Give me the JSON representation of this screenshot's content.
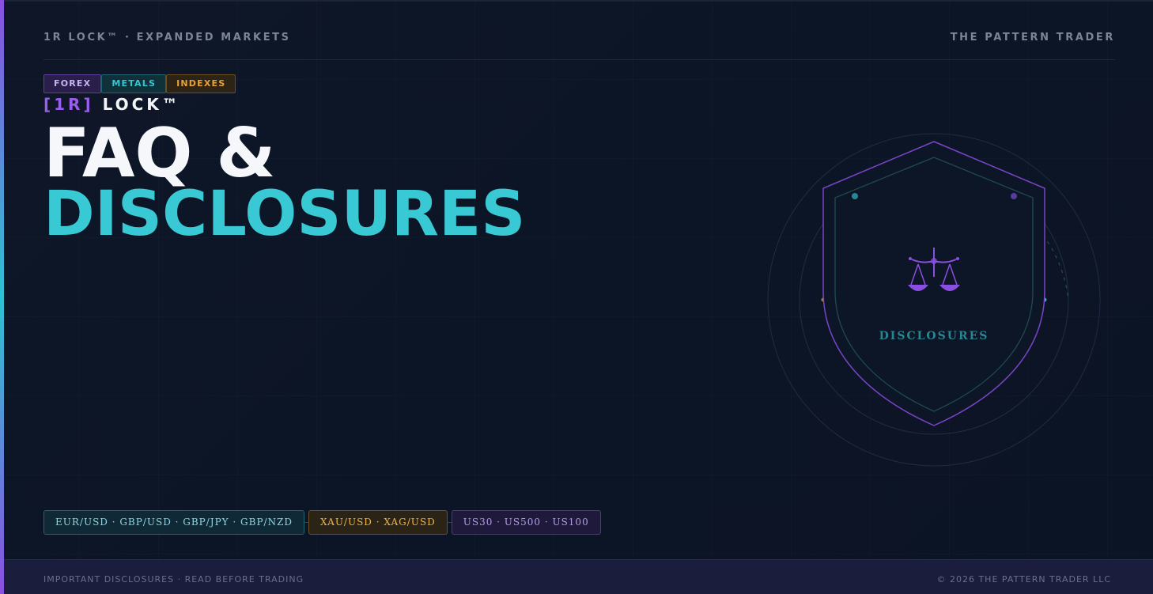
{
  "header": {
    "left": "1R LOCK™ · EXPANDED MARKETS",
    "right": "THE PATTERN TRADER"
  },
  "tags": [
    "FOREX",
    "METALS",
    "INDEXES"
  ],
  "brand": {
    "bracket": "[1R]",
    "word": "LOCK™"
  },
  "title": {
    "line1": "FAQ &",
    "line2": "DISCLOSURES"
  },
  "emblem": {
    "label": "DISCLOSURES",
    "icon": "scales-icon"
  },
  "pills": {
    "forex": "EUR/USD · GBP/USD · GBP/JPY · GBP/NZD",
    "metals": "XAU/USD · XAG/USD",
    "indexes": "US30 · US500 · US100"
  },
  "footer": {
    "left": "IMPORTANT DISCLOSURES · READ BEFORE TRADING",
    "right": "© 2026 THE PATTERN TRADER LLC"
  },
  "colors": {
    "background": "#0e1628",
    "purple": "#9b5cf0",
    "cyan": "#38c9d5",
    "amber": "#e7a13a",
    "footer": "#1a1d3c"
  }
}
